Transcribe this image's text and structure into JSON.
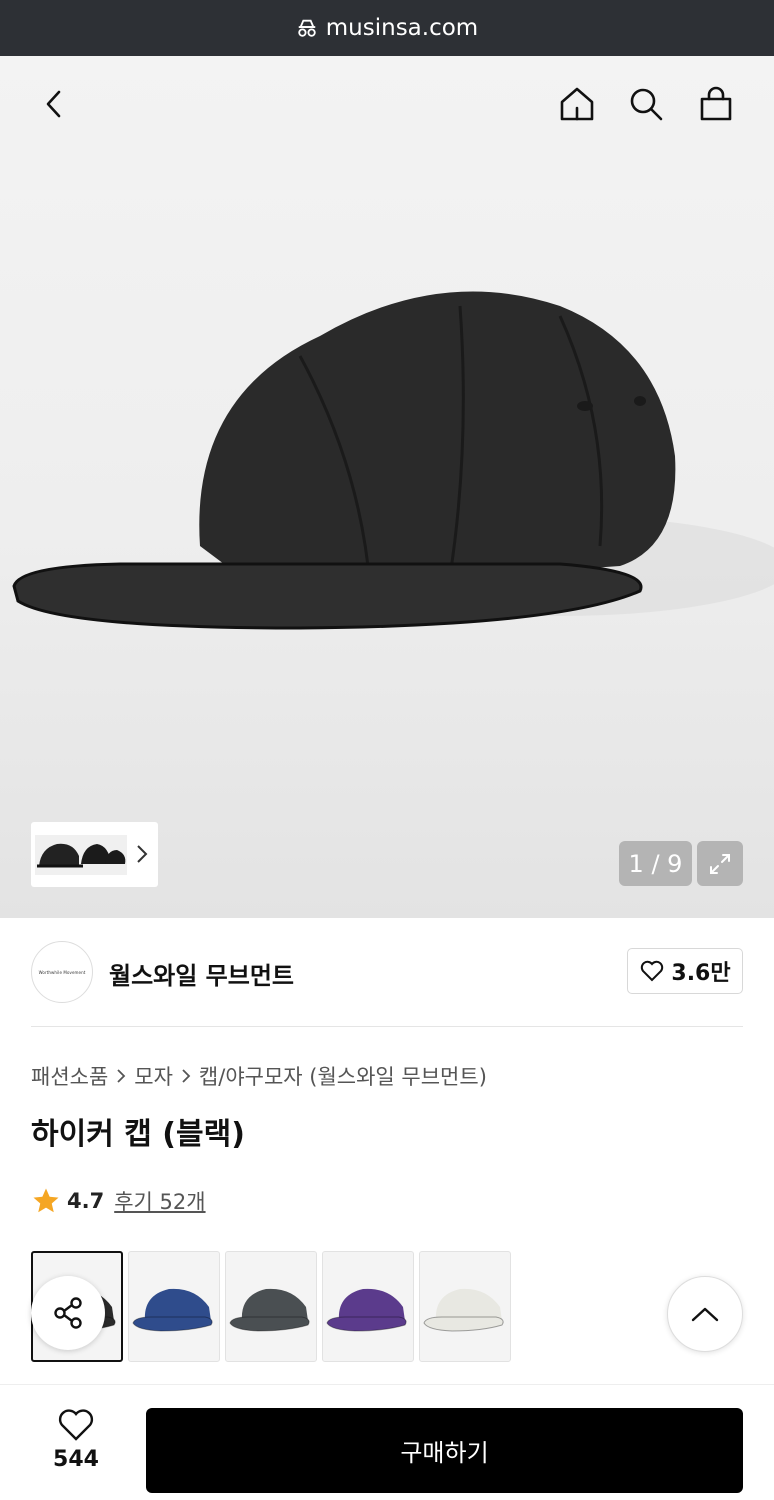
{
  "browser": {
    "domain": "musinsa.com"
  },
  "gallery": {
    "counter": "1 / 9"
  },
  "brand": {
    "name": "월스와일 무브먼트",
    "logo_text": "Worthwhile Movement",
    "likes": "3.6만"
  },
  "breadcrumb": [
    "패션소품",
    "모자",
    "캡/야구모자 (월스와일 무브먼트)"
  ],
  "product": {
    "title": "하이커 캡 (블랙)",
    "rating": "4.7",
    "reviews": "후기 52개"
  },
  "swatches": [
    {
      "color": "#2b2b2b",
      "selected": true
    },
    {
      "color": "#2f4c8c",
      "selected": false
    },
    {
      "color": "#4a4f52",
      "selected": false
    },
    {
      "color": "#5b3b8c",
      "selected": false
    },
    {
      "color": "#e8e8e2",
      "selected": false
    }
  ],
  "bottom": {
    "wish_count": "544",
    "buy_label": "구매하기"
  },
  "colors": {
    "accent_star": "#f5a623",
    "buy_button": "#000000"
  }
}
